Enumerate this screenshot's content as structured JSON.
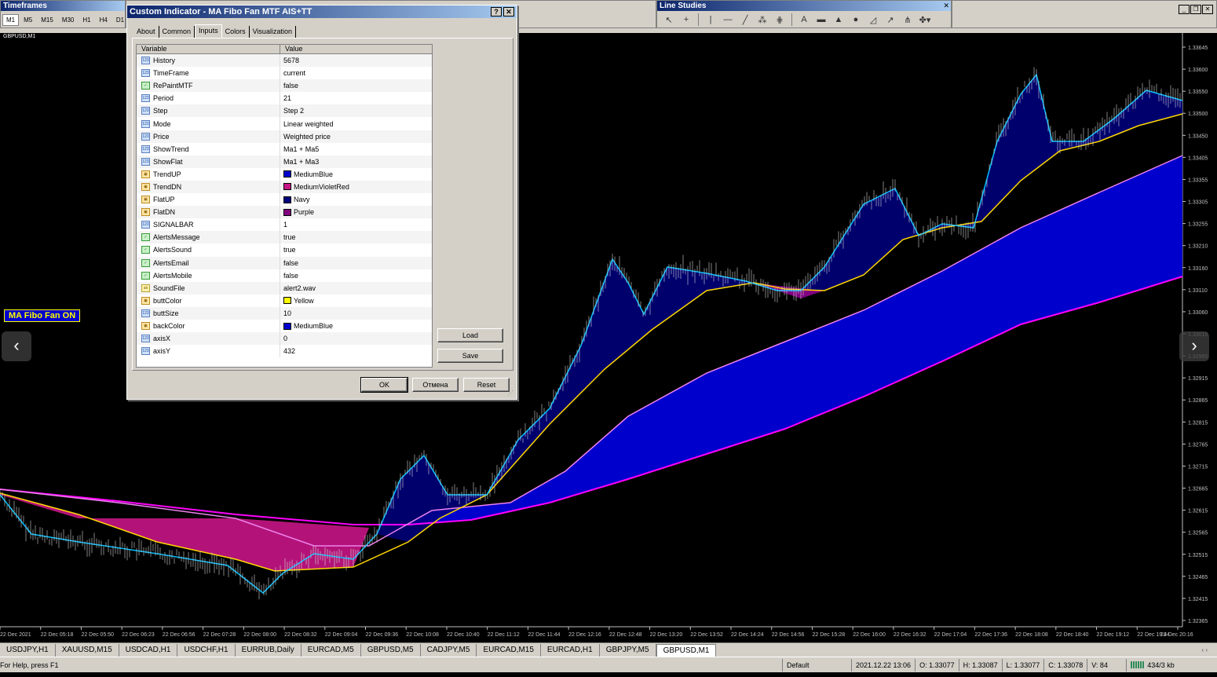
{
  "timeframes": {
    "title": "Timeframes",
    "buttons": [
      "M1",
      "M5",
      "M15",
      "M30",
      "H1",
      "H4",
      "D1"
    ],
    "active": "M1"
  },
  "line_studies": {
    "title": "Line Studies",
    "tools": [
      "cursor-icon",
      "crosshair-icon",
      "vertical-line-icon",
      "horizontal-line-icon",
      "trendline-icon",
      "fibonacci-icon",
      "grid-icon",
      "text-icon",
      "rectangle-icon",
      "triangle-icon",
      "ellipse-icon",
      "fan-icon",
      "arrow-icon",
      "pitchfork-icon",
      "arrows-dropdown-icon"
    ],
    "glyphs": [
      "↖",
      "+",
      "|",
      "—",
      "╱",
      "⁂",
      "⋕",
      "A",
      "▬",
      "▲",
      "●",
      "◿",
      "↗",
      "⋔",
      "✤▾"
    ]
  },
  "chart": {
    "symbol_label": "GBPUSD,M1",
    "indicator_button": "MA Fibo Fan ON",
    "price_ticks": [
      "1.33645",
      "1.33600",
      "1.33550",
      "1.33500",
      "1.33450",
      "1.33405",
      "1.33355",
      "1.33305",
      "1.33255",
      "1.33210",
      "1.33160",
      "1.33110",
      "1.33060",
      "1.33015",
      "1.32965",
      "1.32915",
      "1.32865",
      "1.32815",
      "1.32765",
      "1.32715",
      "1.32665",
      "1.32615",
      "1.32565",
      "1.32515",
      "1.32465",
      "1.32415",
      "1.32365"
    ],
    "time_ticks": [
      "22 Dec 2021",
      "22 Dec 05:18",
      "22 Dec 05:50",
      "22 Dec 06:23",
      "22 Dec 06:56",
      "22 Dec 07:28",
      "22 Dec 08:00",
      "22 Dec 08:32",
      "22 Dec 09:04",
      "22 Dec 09:36",
      "22 Dec 10:08",
      "22 Dec 10:40",
      "22 Dec 11:12",
      "22 Dec 11:44",
      "22 Dec 12:16",
      "22 Dec 12:48",
      "22 Dec 13:20",
      "22 Dec 13:52",
      "22 Dec 14:24",
      "22 Dec 14:56",
      "22 Dec 15:28",
      "22 Dec 16:00",
      "22 Dec 16:32",
      "22 Dec 17:04",
      "22 Dec 17:36",
      "22 Dec 18:08",
      "22 Dec 18:40",
      "22 Dec 19:12",
      "22 Dec 19:44",
      "22 Dec 20:16"
    ],
    "colors": {
      "trend_up": "#0000cd",
      "trend_dn": "#c71585",
      "flat_up": "#000080",
      "flat_dn": "#800080",
      "slow_line": "#ff00ff",
      "mid_line": "#ee82ee",
      "fast_line": "#00bfff",
      "yellow_line": "#ffd700"
    }
  },
  "dialog": {
    "title": "Custom Indicator - MA Fibo Fan MTF AIS+TT",
    "help_glyph": "?",
    "close_glyph": "✕",
    "tabs": [
      "About",
      "Common",
      "Inputs",
      "Colors",
      "Visualization"
    ],
    "active_tab": "Inputs",
    "columns": {
      "variable": "Variable",
      "value": "Value"
    },
    "params": [
      {
        "name": "History",
        "value": "5678",
        "type": "int",
        "icon": "123"
      },
      {
        "name": "TimeFrame",
        "value": "current",
        "type": "int",
        "icon": "123"
      },
      {
        "name": "RePaintMTF",
        "value": "false",
        "type": "bool",
        "icon": "✓"
      },
      {
        "name": "Period",
        "value": "21",
        "type": "int",
        "icon": "123"
      },
      {
        "name": "Step",
        "value": "Step 2",
        "type": "int",
        "icon": "123"
      },
      {
        "name": "Mode",
        "value": "Linear weighted",
        "type": "int",
        "icon": "123"
      },
      {
        "name": "Price",
        "value": "Weighted price",
        "type": "int",
        "icon": "123"
      },
      {
        "name": "ShowTrend",
        "value": "Ma1 + Ma5",
        "type": "int",
        "icon": "123"
      },
      {
        "name": "ShowFlat",
        "value": "Ma1 + Ma3",
        "type": "int",
        "icon": "123"
      },
      {
        "name": "TrendUP",
        "value": "MediumBlue",
        "type": "color",
        "icon": "▣",
        "swatch": "#0000cd"
      },
      {
        "name": "TrendDN",
        "value": "MediumVioletRed",
        "type": "color",
        "icon": "▣",
        "swatch": "#c71585"
      },
      {
        "name": "FlatUP",
        "value": "Navy",
        "type": "color",
        "icon": "▣",
        "swatch": "#000080"
      },
      {
        "name": "FlatDN",
        "value": "Purple",
        "type": "color",
        "icon": "▣",
        "swatch": "#800080"
      },
      {
        "name": "SIGNALBAR",
        "value": "1",
        "type": "int",
        "icon": "123"
      },
      {
        "name": "AlertsMessage",
        "value": "true",
        "type": "bool",
        "icon": "✓"
      },
      {
        "name": "AlertsSound",
        "value": "true",
        "type": "bool",
        "icon": "✓"
      },
      {
        "name": "AlertsEmail",
        "value": "false",
        "type": "bool",
        "icon": "✓"
      },
      {
        "name": "AlertsMobile",
        "value": "false",
        "type": "bool",
        "icon": "✓"
      },
      {
        "name": "SoundFile",
        "value": "alert2.wav",
        "type": "str",
        "icon": "ab"
      },
      {
        "name": "buttColor",
        "value": "Yellow",
        "type": "color",
        "icon": "▣",
        "swatch": "#ffff00"
      },
      {
        "name": "buttSize",
        "value": "10",
        "type": "int",
        "icon": "123"
      },
      {
        "name": "backColor",
        "value": "MediumBlue",
        "type": "color",
        "icon": "▣",
        "swatch": "#0000cd"
      },
      {
        "name": "axisX",
        "value": "0",
        "type": "int",
        "icon": "123"
      },
      {
        "name": "axisY",
        "value": "432",
        "type": "int",
        "icon": "123"
      }
    ],
    "buttons": {
      "load": "Load",
      "save": "Save",
      "ok": "OK",
      "cancel": "Отмена",
      "reset": "Reset"
    }
  },
  "nav": {
    "prev": "‹",
    "next": "›"
  },
  "tabs": [
    "USDJPY,H1",
    "XAUUSD,M15",
    "USDCAD,H1",
    "USDCHF,H1",
    "EURRUB,Daily",
    "EURCAD,M5",
    "GBPUSD,M5",
    "CADJPY,M5",
    "EURCAD,M15",
    "EURCAD,H1",
    "GBPJPY,M5",
    "GBPUSD,M1"
  ],
  "active_tab": "GBPUSD,M1",
  "status": {
    "help": "For Help, press F1",
    "profile": "Default",
    "datetime": "2021.12.22 13:06",
    "open": "O: 1.33077",
    "high": "H: 1.33087",
    "low": "L: 1.33077",
    "close": "C: 1.33078",
    "volume": "V: 84",
    "traffic": "434/3 kb"
  }
}
